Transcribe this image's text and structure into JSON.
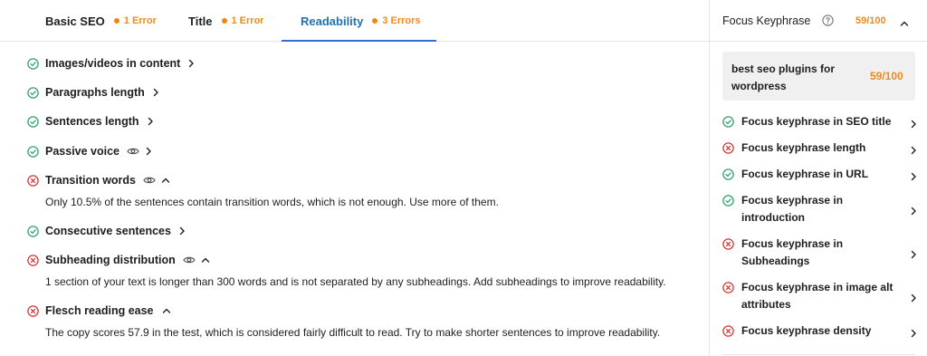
{
  "tabs": [
    {
      "label": "Basic SEO",
      "errors": "1 Error"
    },
    {
      "label": "Title",
      "errors": "1 Error"
    },
    {
      "label": "Readability",
      "errors": "3 Errors"
    }
  ],
  "readability": {
    "items": [
      {
        "label": "Images/videos in content",
        "status": "good"
      },
      {
        "label": "Paragraphs length",
        "status": "good"
      },
      {
        "label": "Sentences length",
        "status": "good"
      },
      {
        "label": "Passive voice",
        "status": "good"
      },
      {
        "label": "Transition words",
        "status": "error",
        "description": "Only 10.5% of the sentences contain transition words, which is not enough. Use more of them."
      },
      {
        "label": "Consecutive sentences",
        "status": "good"
      },
      {
        "label": "Subheading distribution",
        "status": "error",
        "description": "1 section of your text is longer than 300 words and is not separated by any subheadings. Add subheadings to improve readability."
      },
      {
        "label": "Flesch reading ease",
        "status": "error",
        "description": "The copy scores 57.9 in the test, which is considered fairly difficult to read. Try to make shorter sentences to improve readability."
      }
    ]
  },
  "focus_keyphrase": {
    "title": "Focus Keyphrase",
    "score": "59/100",
    "value": "best seo plugins for wordpress",
    "box_score": "59/100",
    "checks": [
      {
        "label": "Focus keyphrase in SEO title",
        "status": "good"
      },
      {
        "label": "Focus keyphrase length",
        "status": "error"
      },
      {
        "label": "Focus keyphrase in URL",
        "status": "good"
      },
      {
        "label": "Focus keyphrase in introduction",
        "status": "good"
      },
      {
        "label": "Focus keyphrase in Subheadings",
        "status": "error"
      },
      {
        "label": "Focus keyphrase in image alt attributes",
        "status": "error"
      },
      {
        "label": "Focus keyphrase density",
        "status": "error"
      }
    ]
  },
  "colors": {
    "good": "#2fa36b",
    "error": "#d63638",
    "warning": "#ee8a1e",
    "accent": "#2271b1"
  },
  "icons": [
    "check-circle-icon",
    "x-circle-icon",
    "eye-icon",
    "chevron-right-icon",
    "chevron-up-icon",
    "help-icon"
  ]
}
